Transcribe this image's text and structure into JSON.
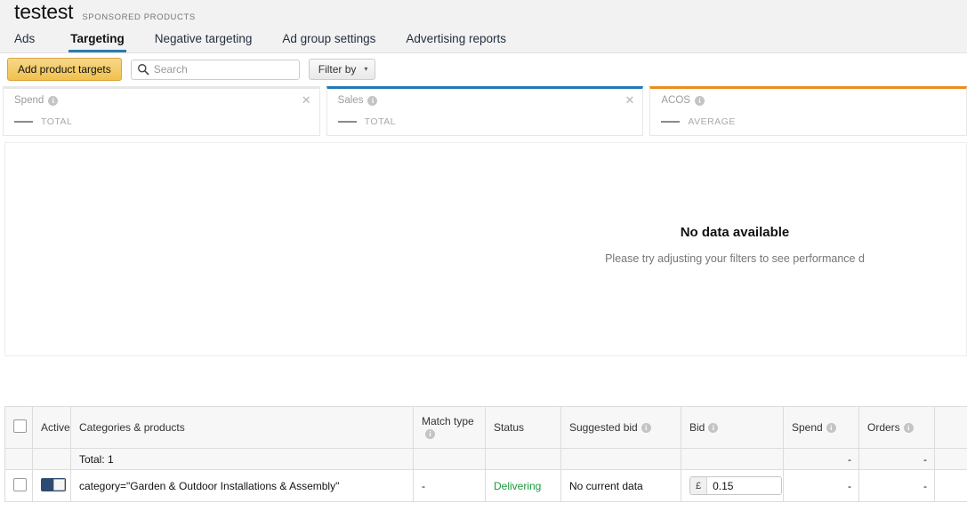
{
  "header": {
    "brand": "testest",
    "brand_sub": "SPONSORED PRODUCTS",
    "tabs": [
      {
        "label": "Ads",
        "active": false
      },
      {
        "label": "Targeting",
        "active": true
      },
      {
        "label": "Negative targeting",
        "active": false
      },
      {
        "label": "Ad group settings",
        "active": false
      },
      {
        "label": "Advertising reports",
        "active": false
      }
    ],
    "active_tab_underline_color": "#2c7cb0"
  },
  "toolbar": {
    "add_button_label": "Add product targets",
    "add_button_color": "#f0c14b",
    "search_placeholder": "Search",
    "search_value": "",
    "search_icon": "search-icon",
    "filter_label": "Filter by",
    "filter_caret": "chevron-down-icon"
  },
  "metric_cards": [
    {
      "title": "Spend",
      "legend_label": "TOTAL",
      "accent_color": "#e7e7e7",
      "close_icon": "close-icon",
      "info_icon": "info-icon"
    },
    {
      "title": "Sales",
      "legend_label": "TOTAL",
      "accent_color": "#2279b5",
      "close_icon": "close-icon",
      "info_icon": "info-icon"
    },
    {
      "title": "ACOS",
      "legend_label": "AVERAGE",
      "accent_color": "#ec8b1f",
      "close_icon": "",
      "info_icon": "info-icon"
    }
  ],
  "chart": {
    "empty_title": "No data available",
    "empty_subtitle": "Please try adjusting your filters to see performance d"
  },
  "table": {
    "columns": [
      {
        "label": "",
        "name": "select-all-column",
        "info": false
      },
      {
        "label": "Active",
        "name": "active-column",
        "info": false
      },
      {
        "label": "Categories & products",
        "name": "categories-products-column",
        "info": false
      },
      {
        "label": "Match type",
        "name": "match-type-column",
        "info": true
      },
      {
        "label": "Status",
        "name": "status-column",
        "info": false
      },
      {
        "label": "Suggested bid",
        "name": "suggested-bid-column",
        "info": true
      },
      {
        "label": "Bid",
        "name": "bid-column",
        "info": true
      },
      {
        "label": "Spend",
        "name": "spend-column",
        "info": true
      },
      {
        "label": "Orders",
        "name": "orders-column",
        "info": true
      },
      {
        "label": "",
        "name": "extra-column",
        "info": false
      }
    ],
    "total_row": {
      "label_prefix": "Total: ",
      "label_count": "1",
      "match_type": "",
      "status": "",
      "suggested_bid": "",
      "bid": "",
      "spend": "-",
      "orders": "-"
    },
    "rows": [
      {
        "checked": false,
        "toggle_on": true,
        "name": "category=\"Garden & Outdoor Installations & Assembly\"",
        "match_type": "-",
        "status": "Delivering",
        "status_color": "#1a9a3c",
        "suggested_bid": "No current data",
        "bid_currency": "£",
        "bid_value": "0.15",
        "spend": "-",
        "orders": "-"
      }
    ]
  }
}
